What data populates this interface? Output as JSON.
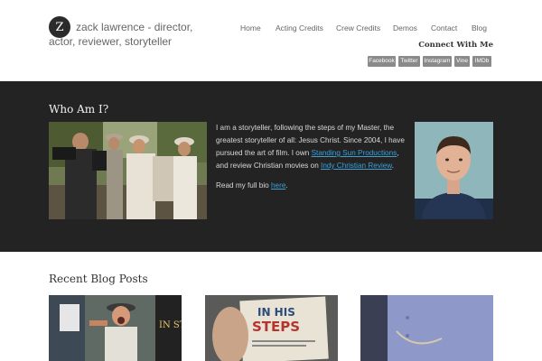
{
  "site": {
    "logo_letter": "Z",
    "title": "zack lawrence - director, actor, reviewer, storyteller"
  },
  "nav": {
    "items": [
      {
        "label": "Home"
      },
      {
        "label": "Acting Credits"
      },
      {
        "label": "Crew Credits"
      },
      {
        "label": "Demos"
      },
      {
        "label": "Contact"
      },
      {
        "label": "Blog"
      }
    ],
    "connect_label": "Connect With Me",
    "social": [
      {
        "label": "Facebook"
      },
      {
        "label": "Twitter"
      },
      {
        "label": "Instagram"
      },
      {
        "label": "Vine"
      },
      {
        "label": "IMDb"
      }
    ]
  },
  "about": {
    "heading": "Who Am I?",
    "bio_intro": "I am a storyteller, following the steps of my Master, the greatest storyteller of all: Jesus Christ. Since 2004, I have pursued the art of film. I own ",
    "link1": "Standing Sun Productions",
    "bio_mid": ", and review Christian movies on ",
    "link2": "Indy Christian Review",
    "bio_end": ".",
    "more_prefix": "Read my full bio ",
    "more_link": "here",
    "more_suffix": "."
  },
  "posts": {
    "heading": "Recent Blog Posts",
    "thumb2_text_line1": "IN HIS",
    "thumb2_text_line2": "STEPS",
    "thumb1_text": "IN STE"
  },
  "colors": {
    "band_bg": "#232323",
    "link": "#3aa0d8",
    "social_bg": "#8a8a8a"
  }
}
